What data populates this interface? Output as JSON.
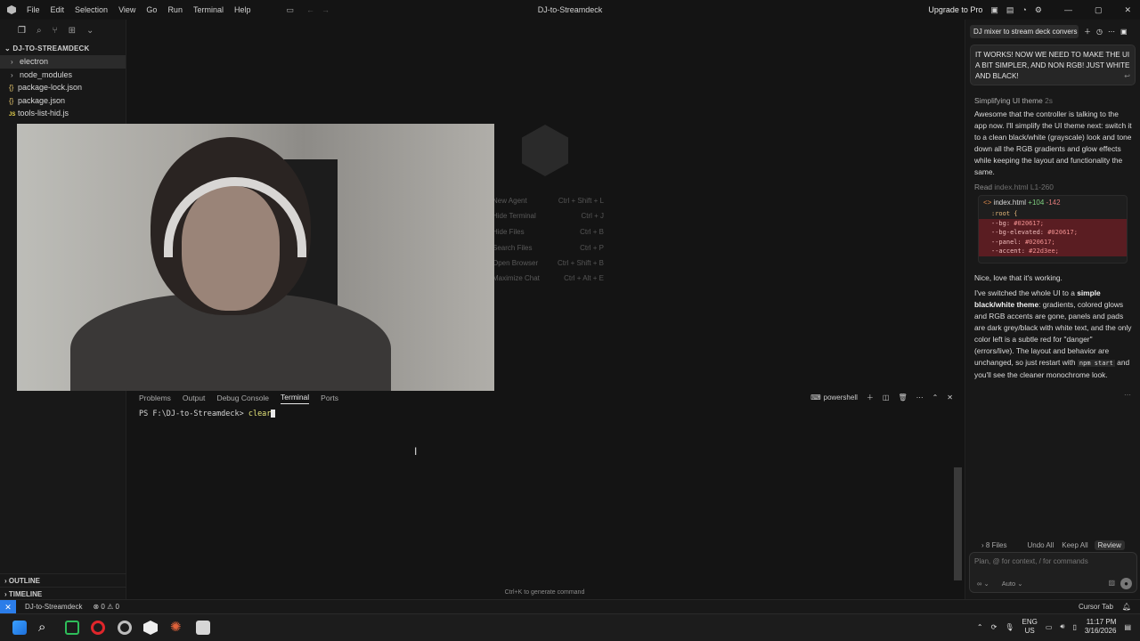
{
  "window": {
    "title": "DJ-to-Streamdeck",
    "menu": [
      "File",
      "Edit",
      "Selection",
      "View",
      "Go",
      "Run",
      "Terminal",
      "Help"
    ],
    "upgrade_label": "Upgrade to Pro"
  },
  "explorer": {
    "header": "DJ-TO-STREAMDECK",
    "items": [
      {
        "label": "electron",
        "kind": "folder",
        "icon": "chevron-right-icon"
      },
      {
        "label": "node_modules",
        "kind": "folder",
        "icon": "chevron-right-icon"
      },
      {
        "label": "package-lock.json",
        "kind": "json",
        "icon": "{}"
      },
      {
        "label": "package.json",
        "kind": "json",
        "icon": "{}"
      },
      {
        "label": "tools-list-hid.js",
        "kind": "js",
        "icon": "JS"
      }
    ],
    "outline_label": "OUTLINE",
    "timeline_label": "TIMELINE"
  },
  "empty_editor": {
    "shortcuts": [
      {
        "label": "New Agent",
        "keys": "Ctrl + Shift + L"
      },
      {
        "label": "Hide Terminal",
        "keys": "Ctrl + J"
      },
      {
        "label": "Hide Files",
        "keys": "Ctrl + B"
      },
      {
        "label": "Search Files",
        "keys": "Ctrl + P"
      },
      {
        "label": "Open Browser",
        "keys": "Ctrl + Shift + B"
      },
      {
        "label": "Maximize Chat",
        "keys": "Ctrl + Alt + E"
      }
    ]
  },
  "panel": {
    "tabs": [
      "Problems",
      "Output",
      "Debug Console",
      "Terminal",
      "Ports"
    ],
    "active_tab": "Terminal",
    "shell_label": "powershell",
    "prompt": "PS F:\\DJ-to-Streamdeck>",
    "command": "clear",
    "hint": "Ctrl+K to generate command"
  },
  "chat": {
    "title": "DJ mixer to stream deck convers",
    "user_message": "IT WORKS! NOW WE NEED TO MAKE THE UI A BIT SIMPLER, AND NON RGB! JUST WHITE AND BLACK!",
    "thought_label": "Simplifying UI theme",
    "thought_time": "2s",
    "reply_1": "Awesome that the controller is talking to the app now. I'll simplify the UI theme next: switch it to a clean black/white (grayscale) look and tone down all the RGB gradients and glow effects while keeping the layout and functionality the same.",
    "read_label": "Read",
    "read_file": "index.html L1-260",
    "diff": {
      "file": "index.html",
      "added": "+104",
      "removed": "-142",
      "lines": [
        {
          "text": ":root {",
          "del": false
        },
        {
          "text": "  --bg: ",
          "val": "#020617;",
          "del": true
        },
        {
          "text": "  --bg-elevated: ",
          "val": "#020617;",
          "del": true
        },
        {
          "text": "  --panel: ",
          "val": "#020617;",
          "del": true
        },
        {
          "text": "  --accent: ",
          "val": "#22d3ee;",
          "del": true
        }
      ]
    },
    "reply_2": "Nice, love that it's working.",
    "reply_3a": "I've switched the whole UI to a ",
    "reply_3b": "simple black/white theme",
    "reply_3c": ": gradients, colored glows and RGB accents are gone, panels and pads are dark grey/black with white text, and the only color left is a subtle red for \"danger\" (errors/live). The layout and behavior are unchanged, so just restart with ",
    "reply_3d": "npm start",
    "reply_3e": " and you'll see the cleaner monochrome look.",
    "files_label": "8 Files",
    "undo_all": "Undo All",
    "keep_all": "Keep All",
    "review": "Review",
    "input_placeholder": "Plan, @ for context, / for commands",
    "mode_label": "∞",
    "model_label": "Auto"
  },
  "statusbar": {
    "project": "DJ-to-Streamdeck",
    "problems": "⊗ 0 ⚠ 0",
    "cursor_tab": "Cursor Tab"
  },
  "taskbar": {
    "lang": "ENG",
    "region": "US",
    "time": "11:17 PM",
    "date": "3/16/2026"
  },
  "colors": {
    "accent": "#2b7de9",
    "diff_del_bg": "#5a1d22"
  }
}
